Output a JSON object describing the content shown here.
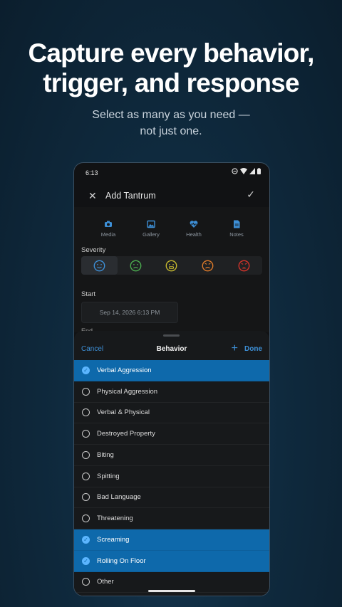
{
  "promo": {
    "headline_line1": "Capture every behavior,",
    "headline_line2": "trigger, and response",
    "sub_line1": "Select as many as you need —",
    "sub_line2": "not just one."
  },
  "status": {
    "time": "6:13"
  },
  "appbar": {
    "title": "Add Tantrum"
  },
  "tabs": [
    {
      "label": "Media",
      "icon": "camera-icon"
    },
    {
      "label": "Gallery",
      "icon": "gallery-icon"
    },
    {
      "label": "Health",
      "icon": "heart-icon"
    },
    {
      "label": "Notes",
      "icon": "notes-icon"
    }
  ],
  "severity": {
    "label": "Severity",
    "selected_index": 0,
    "faces": [
      {
        "name": "smile-face-icon",
        "color": "#3d8fd6"
      },
      {
        "name": "frown-face-icon",
        "color": "#4caf50"
      },
      {
        "name": "grimace-face-icon",
        "color": "#c6b92f"
      },
      {
        "name": "angry-face-icon",
        "color": "#e07b2a"
      },
      {
        "name": "furious-face-icon",
        "color": "#d9342b"
      }
    ]
  },
  "start": {
    "label": "Start",
    "value": "Sep 14, 2026 6:13 PM"
  },
  "end": {
    "label": "End"
  },
  "sheet": {
    "cancel": "Cancel",
    "title": "Behavior",
    "done": "Done",
    "items": [
      {
        "label": "Verbal Aggression",
        "selected": true
      },
      {
        "label": "Physical Aggression",
        "selected": false
      },
      {
        "label": "Verbal & Physical",
        "selected": false
      },
      {
        "label": "Destroyed Property",
        "selected": false
      },
      {
        "label": "Biting",
        "selected": false
      },
      {
        "label": "Spitting",
        "selected": false
      },
      {
        "label": "Bad Language",
        "selected": false
      },
      {
        "label": "Threatening",
        "selected": false
      },
      {
        "label": "Screaming",
        "selected": true
      },
      {
        "label": "Rolling On Floor",
        "selected": true
      },
      {
        "label": "Other",
        "selected": false
      }
    ]
  },
  "colors": {
    "accent": "#3d8fd6",
    "selected_row": "#0e69ab"
  }
}
